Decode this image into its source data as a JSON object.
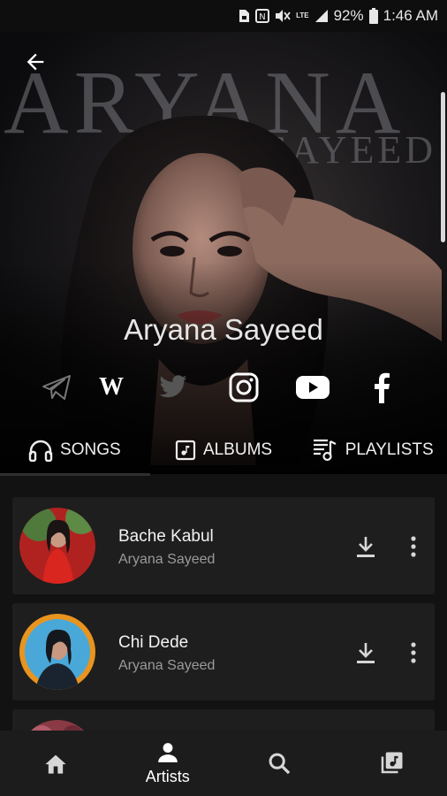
{
  "status_bar": {
    "battery": "92%",
    "time": "1:46 AM",
    "network": "LTE"
  },
  "hero": {
    "bg_word": "ARYANA",
    "bg_word2": "SAYEED",
    "artist_name": "Aryana Sayeed"
  },
  "social": [
    {
      "name": "telegram-icon"
    },
    {
      "name": "wikipedia-icon",
      "glyph": "W"
    },
    {
      "name": "twitter-icon"
    },
    {
      "name": "instagram-icon"
    },
    {
      "name": "youtube-icon"
    },
    {
      "name": "facebook-icon",
      "glyph": "f"
    }
  ],
  "tabs": [
    {
      "label": "SONGS",
      "icon": "headphones-icon",
      "active": true
    },
    {
      "label": "ALBUMS",
      "icon": "album-icon",
      "active": false
    },
    {
      "label": "PLAYLISTS",
      "icon": "playlist-icon",
      "active": false
    }
  ],
  "songs": [
    {
      "title": "Bache Kabul",
      "artist": "Aryana Sayeed"
    },
    {
      "title": "Chi Dede",
      "artist": "Aryana Sayeed"
    }
  ],
  "bottom_nav": [
    {
      "icon": "home-icon",
      "label": ""
    },
    {
      "icon": "person-icon",
      "label": "Artists",
      "active": true
    },
    {
      "icon": "search-icon",
      "label": ""
    },
    {
      "icon": "library-icon",
      "label": ""
    }
  ],
  "colors": {
    "background": "#121212",
    "card": "#1e1e1e",
    "muted_text": "#9a9a9a"
  }
}
